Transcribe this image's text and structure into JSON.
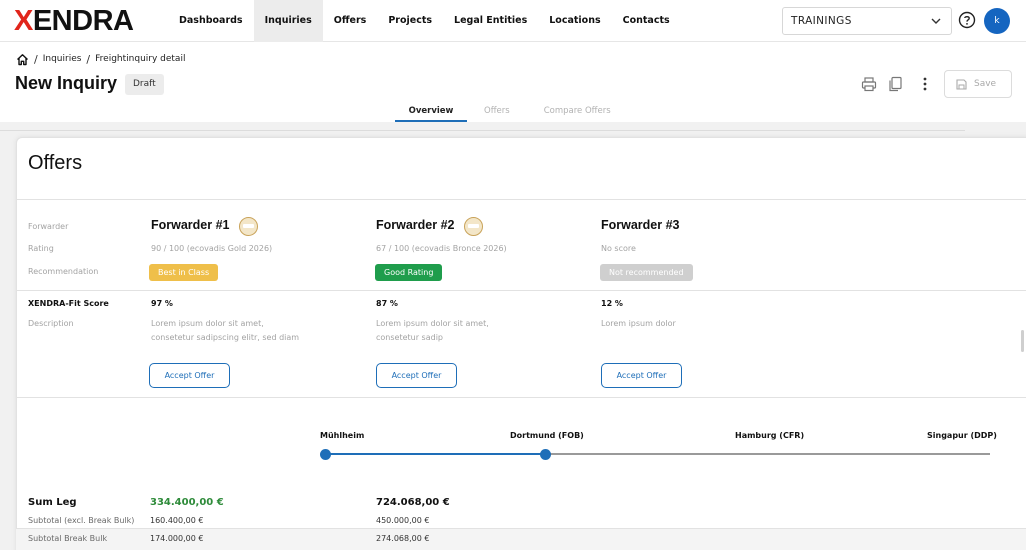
{
  "brand": {
    "logo_x": "X",
    "logo_rest": "ENDRA",
    "accent_color": "#e1251b",
    "primary_color": "#1e6eb8"
  },
  "nav": {
    "items": [
      {
        "label": "Dashboards",
        "active": false
      },
      {
        "label": "Inquiries",
        "active": true
      },
      {
        "label": "Offers",
        "active": false
      },
      {
        "label": "Projects",
        "active": false
      },
      {
        "label": "Legal Entities",
        "active": false
      },
      {
        "label": "Locations",
        "active": false
      },
      {
        "label": "Contacts",
        "active": false
      }
    ],
    "workspace_select": "TRAININGS",
    "avatar_initial": "k",
    "icons": {
      "select": "chevron-down-icon",
      "help": "help-circle-icon"
    }
  },
  "breadcrumb": {
    "items": [
      "Inquiries",
      "Freightinquiry detail"
    ],
    "home_icon": "home-icon"
  },
  "header": {
    "title": "New Inquiry",
    "status": "Draft",
    "save_label": "Save",
    "tool_icons": [
      "print-icon",
      "copy-icon",
      "more-vertical-icon",
      "save-icon"
    ]
  },
  "tabs": [
    {
      "label": "Overview",
      "active": true
    },
    {
      "label": "Offers",
      "active": false
    },
    {
      "label": "Compare Offers",
      "active": false
    }
  ],
  "offers_section": {
    "title": "Offers",
    "row_labels": {
      "forwarder": "Forwarder",
      "rating": "Rating",
      "recommendation": "Recommendation",
      "fit_score": "XENDRA-Fit Score",
      "description": "Description"
    },
    "accept_label": "Accept Offer",
    "forwarders": [
      {
        "name": "Forwarder #1",
        "has_medal": true,
        "rating": "90 / 100 (ecovadis Gold 2026)",
        "recommendation": "Best in Class",
        "recommendation_color": "#efbf4a",
        "fit_score": "97 %",
        "description": "Lorem ipsum dolor sit amet, consetetur sadipscing elitr, sed diam"
      },
      {
        "name": "Forwarder #2",
        "has_medal": true,
        "rating": "67 / 100 (ecovadis Bronce 2026)",
        "recommendation": "Good Rating",
        "recommendation_color": "#1f9d4c",
        "fit_score": "87 %",
        "description": "Lorem ipsum dolor sit amet, consetetur sadip"
      },
      {
        "name": "Forwarder #3",
        "has_medal": false,
        "rating": "No score",
        "recommendation": "Not recommended",
        "recommendation_color": "#cfcfcf",
        "fit_score": "12 %",
        "description": "Lorem ipsum dolor"
      }
    ]
  },
  "route": {
    "stops": [
      "Mühlheim",
      "Dortmund (FOB)",
      "Hamburg (CFR)",
      "Singapur (DDP)"
    ],
    "completed_color": "#1e6eb8",
    "pending_color": "#9a9a9a"
  },
  "legs": {
    "sum_label": "Sum Leg",
    "subtotal_label": "Subtotal (excl. Break Bulk)",
    "break_bulk_label": "Subtotal Break Bulk",
    "columns": [
      {
        "sum": "334.400,00 €",
        "subtotal": "160.400,00 €",
        "break_bulk": "174.000,00 €",
        "sum_color": "#2e8b3a"
      },
      {
        "sum": "724.068,00 €",
        "subtotal": "450.000,00 €",
        "break_bulk": "274.068,00 €",
        "sum_color": "#111111"
      }
    ]
  }
}
